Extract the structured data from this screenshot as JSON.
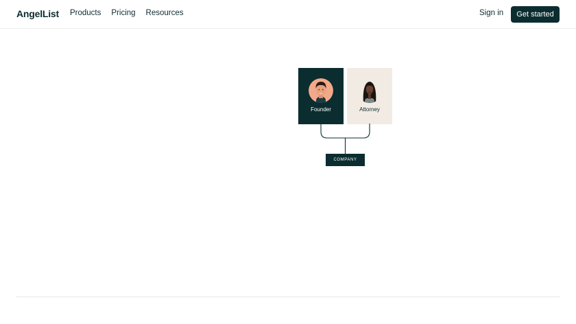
{
  "header": {
    "logo": "AngelList",
    "nav": [
      {
        "label": "Products"
      },
      {
        "label": "Pricing"
      },
      {
        "label": "Resources"
      }
    ],
    "sign_in": "Sign in",
    "get_started": "Get started"
  },
  "diagram": {
    "founder_label": "Founder",
    "attorney_label": "Attorney",
    "company_label": "COMPANY"
  }
}
